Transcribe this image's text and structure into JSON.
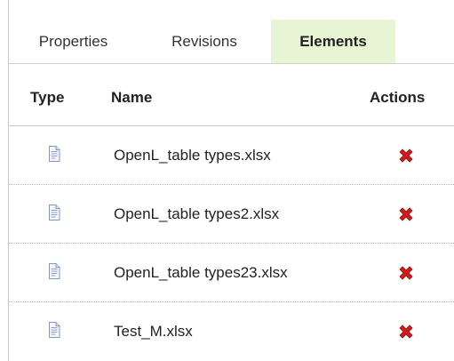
{
  "tabs": [
    {
      "label": "Properties",
      "active": false
    },
    {
      "label": "Revisions",
      "active": false
    },
    {
      "label": "Elements",
      "active": true
    }
  ],
  "colors": {
    "active_tab_bg": "#e8f5d5",
    "delete_icon": "#d41b1b",
    "doc_icon": "#7f97c2"
  },
  "table": {
    "headers": {
      "type": "Type",
      "name": "Name",
      "actions": "Actions"
    },
    "rows": [
      {
        "type_icon": "document-icon",
        "name": "OpenL_table types.xlsx",
        "action_icon": "delete-icon"
      },
      {
        "type_icon": "document-icon",
        "name": "OpenL_table types2.xlsx",
        "action_icon": "delete-icon"
      },
      {
        "type_icon": "document-icon",
        "name": "OpenL_table types23.xlsx",
        "action_icon": "delete-icon"
      },
      {
        "type_icon": "document-icon",
        "name": "Test_M.xlsx",
        "action_icon": "delete-icon"
      }
    ]
  }
}
